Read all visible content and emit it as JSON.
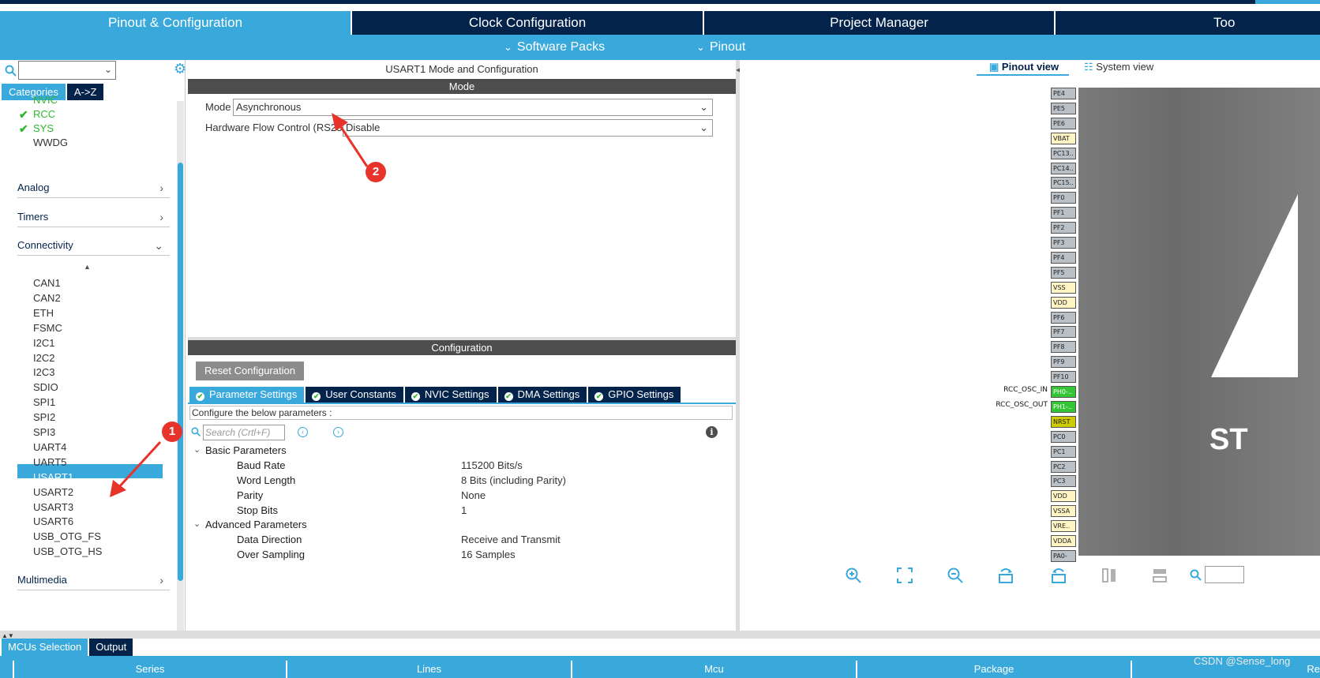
{
  "main_tabs": [
    {
      "label": "Pinout & Configuration",
      "active": true
    },
    {
      "label": "Clock Configuration",
      "active": false
    },
    {
      "label": "Project Manager",
      "active": false
    },
    {
      "label": "Too",
      "active": false
    }
  ],
  "sub_menu": {
    "software_packs": "Software Packs",
    "pinout": "Pinout"
  },
  "left_panel": {
    "tabs": {
      "categories": "Categories",
      "a_to_z": "A->Z"
    },
    "system_core_items": [
      {
        "label": "NVIC",
        "checked": false
      },
      {
        "label": "RCC",
        "checked": true
      },
      {
        "label": "SYS",
        "checked": true
      },
      {
        "label": "WWDG",
        "checked": false
      }
    ],
    "categories": {
      "analog": "Analog",
      "timers": "Timers",
      "connectivity": "Connectivity",
      "multimedia": "Multimedia"
    },
    "connectivity_items": [
      "CAN1",
      "CAN2",
      "ETH",
      "FSMC",
      "I2C1",
      "I2C2",
      "I2C3",
      "SDIO",
      "SPI1",
      "SPI2",
      "SPI3",
      "UART4",
      "UART5",
      "USART1",
      "USART2",
      "USART3",
      "USART6",
      "USB_OTG_FS",
      "USB_OTG_HS"
    ],
    "selected": "USART1"
  },
  "center": {
    "title": "USART1 Mode and Configuration",
    "mode_header": "Mode",
    "mode_label": "Mode",
    "mode_value": "Asynchronous",
    "hwflow_label": "Hardware Flow Control (RS232)",
    "hwflow_value": "Disable",
    "config_header": "Configuration",
    "reset_button": "Reset Configuration",
    "tabs": [
      "Parameter Settings",
      "User Constants",
      "NVIC Settings",
      "DMA Settings",
      "GPIO Settings"
    ],
    "description": "Configure the below parameters :",
    "search_placeholder": "Search (Crtl+F)",
    "basic_group": "Basic Parameters",
    "basic_params": [
      {
        "name": "Baud Rate",
        "value": "115200 Bits/s"
      },
      {
        "name": "Word Length",
        "value": "8 Bits (including Parity)"
      },
      {
        "name": "Parity",
        "value": "None"
      },
      {
        "name": "Stop Bits",
        "value": "1"
      }
    ],
    "advanced_group": "Advanced Parameters",
    "advanced_params": [
      {
        "name": "Data Direction",
        "value": "Receive and Transmit"
      },
      {
        "name": "Over Sampling",
        "value": "16 Samples"
      }
    ]
  },
  "right": {
    "pinout_view": "Pinout view",
    "system_view": "System view",
    "pins": [
      {
        "label": "PE4",
        "color": "gray"
      },
      {
        "label": "PE5",
        "color": "gray"
      },
      {
        "label": "PE6",
        "color": "gray"
      },
      {
        "label": "VBAT",
        "color": "yellow"
      },
      {
        "label": "PC13..",
        "color": "gray"
      },
      {
        "label": "PC14..",
        "color": "gray"
      },
      {
        "label": "PC15..",
        "color": "gray"
      },
      {
        "label": "PF0",
        "color": "gray"
      },
      {
        "label": "PF1",
        "color": "gray"
      },
      {
        "label": "PF2",
        "color": "gray"
      },
      {
        "label": "PF3",
        "color": "gray"
      },
      {
        "label": "PF4",
        "color": "gray"
      },
      {
        "label": "PF5",
        "color": "gray"
      },
      {
        "label": "VSS",
        "color": "yellow"
      },
      {
        "label": "VDD",
        "color": "yellow"
      },
      {
        "label": "PF6",
        "color": "gray"
      },
      {
        "label": "PF7",
        "color": "gray"
      },
      {
        "label": "PF8",
        "color": "gray"
      },
      {
        "label": "PF9",
        "color": "gray"
      },
      {
        "label": "PF10",
        "color": "gray"
      },
      {
        "label": "PH0-..",
        "color": "green"
      },
      {
        "label": "PH1-..",
        "color": "green"
      },
      {
        "label": "NRST",
        "color": "olive"
      },
      {
        "label": "PC0",
        "color": "gray"
      },
      {
        "label": "PC1",
        "color": "gray"
      },
      {
        "label": "PC2",
        "color": "gray"
      },
      {
        "label": "PC3",
        "color": "gray"
      },
      {
        "label": "VDD",
        "color": "yellow"
      },
      {
        "label": "VSSA",
        "color": "yellow"
      },
      {
        "label": "VRE..",
        "color": "yellow"
      },
      {
        "label": "VDDA",
        "color": "yellow"
      },
      {
        "label": "PA0-",
        "color": "gray"
      }
    ],
    "pin_signal_labels": {
      "ph0": "RCC_OSC_IN",
      "ph1": "RCC_OSC_OUT"
    },
    "chip_text": "ST"
  },
  "bottom": {
    "tabs": {
      "mcu_selection": "MCUs Selection",
      "output": "Output"
    },
    "columns": [
      "Series",
      "Lines",
      "Mcu",
      "Package",
      "Re"
    ]
  },
  "annotations": {
    "badge1": "1",
    "badge2": "2"
  },
  "watermark": "CSDN @Sense_long",
  "colors": {
    "accent": "#39a9dc",
    "navy": "#03234b",
    "annotation": "#e8332b"
  }
}
